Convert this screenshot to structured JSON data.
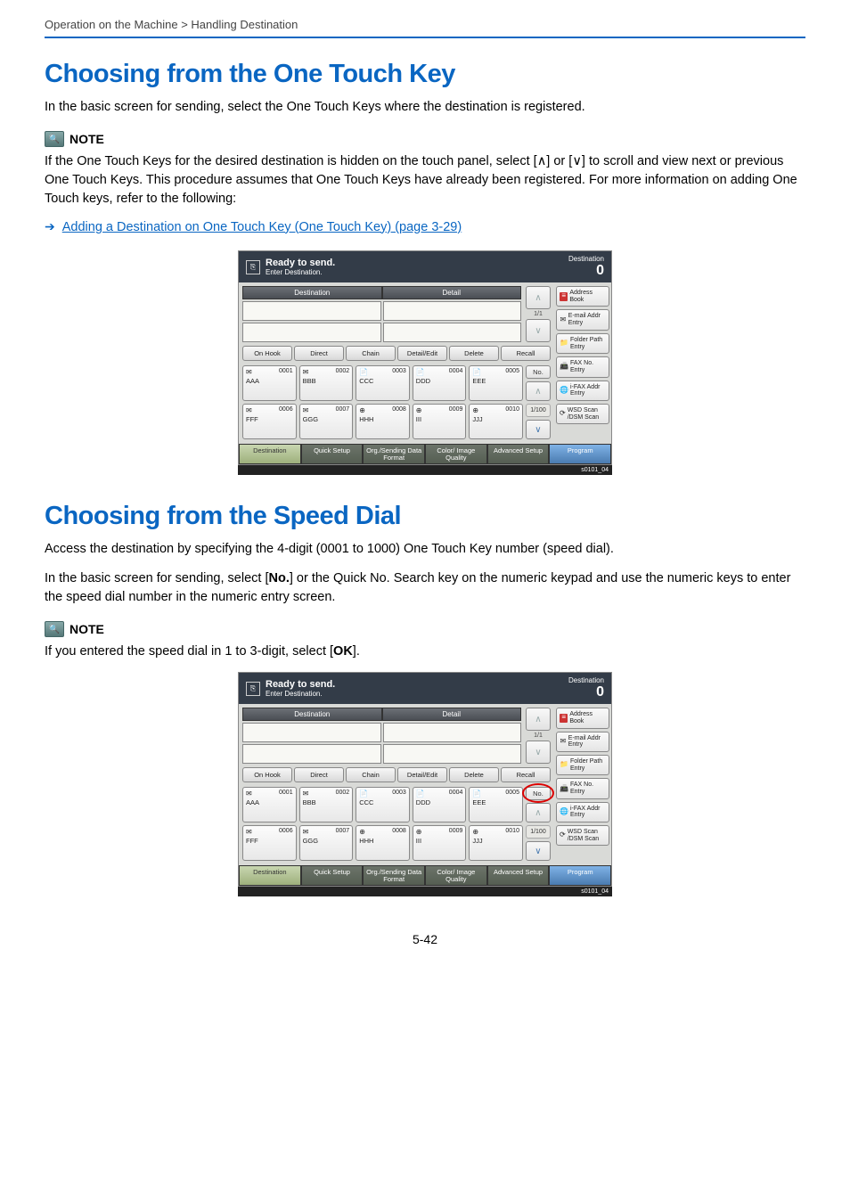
{
  "breadcrumb": "Operation on the Machine > Handling Destination",
  "h1_a": "Choosing from the One Touch Key",
  "p1": "In the basic screen for sending, select the One Touch Keys where the destination is registered.",
  "note_label": "NOTE",
  "note_a": "If the One Touch Keys for the desired destination is hidden on the touch panel, select [∧] or [∨] to scroll and view next or previous One Touch Keys. This procedure assumes that One Touch Keys have already been registered. For more information on adding One Touch keys, refer to the following:",
  "link_a": "Adding a Destination on One Touch Key (One Touch Key) (page 3-29)",
  "h1_b": "Choosing from the Speed Dial",
  "p2": "Access the destination by specifying the 4-digit (0001 to 1000) One Touch Key number (speed dial).",
  "p3_a": "In the basic screen for sending, select [",
  "p3_b": "No.",
  "p3_c": "] or the Quick No. Search key on the numeric keypad and use the numeric keys to enter the speed dial number in the numeric entry screen.",
  "note_b_a": "If you entered the speed dial in 1 to 3-digit, select [",
  "note_b_b": "OK",
  "note_b_c": "].",
  "footer": "5-42",
  "screen": {
    "title_l1": "Ready to send.",
    "title_l2": "Enter Destination.",
    "dest_label": "Destination",
    "dest_count": "0",
    "hdr_dest": "Destination",
    "hdr_detail": "Detail",
    "btns": {
      "onhook": "On Hook",
      "direct": "Direct",
      "chain": "Chain",
      "detail": "Detail/Edit",
      "delete": "Delete",
      "recall": "Recall"
    },
    "side": {
      "addr": "Address Book",
      "email": "E-mail Addr Entry",
      "folder": "Folder Path Entry",
      "faxno": "FAX No. Entry",
      "ifax": "i-FAX Addr Entry",
      "wsd": "WSD Scan /DSM Scan"
    },
    "keys_r1": [
      {
        "num": "0001",
        "name": "AAA",
        "ico": "✉"
      },
      {
        "num": "0002",
        "name": "BBB",
        "ico": "✉"
      },
      {
        "num": "0003",
        "name": "CCC",
        "ico": "📄"
      },
      {
        "num": "0004",
        "name": "DDD",
        "ico": "📄"
      },
      {
        "num": "0005",
        "name": "EEE",
        "ico": "📄"
      }
    ],
    "keys_r2": [
      {
        "num": "0006",
        "name": "FFF",
        "ico": "✉"
      },
      {
        "num": "0007",
        "name": "GGG",
        "ico": "✉"
      },
      {
        "num": "0008",
        "name": "HHH",
        "ico": "⊕"
      },
      {
        "num": "0009",
        "name": "III",
        "ico": "⊕"
      },
      {
        "num": "0010",
        "name": "JJJ",
        "ico": "⊕"
      }
    ],
    "no_btn": "No.",
    "pager_top": "1/1",
    "pager_keys": "1/100",
    "tabs": {
      "dest": "Destination",
      "quick": "Quick Setup",
      "org": "Org./Sending Data Format",
      "color": "Color/ Image Quality",
      "adv": "Advanced Setup",
      "prog": "Program"
    },
    "status": "s0101_04"
  }
}
